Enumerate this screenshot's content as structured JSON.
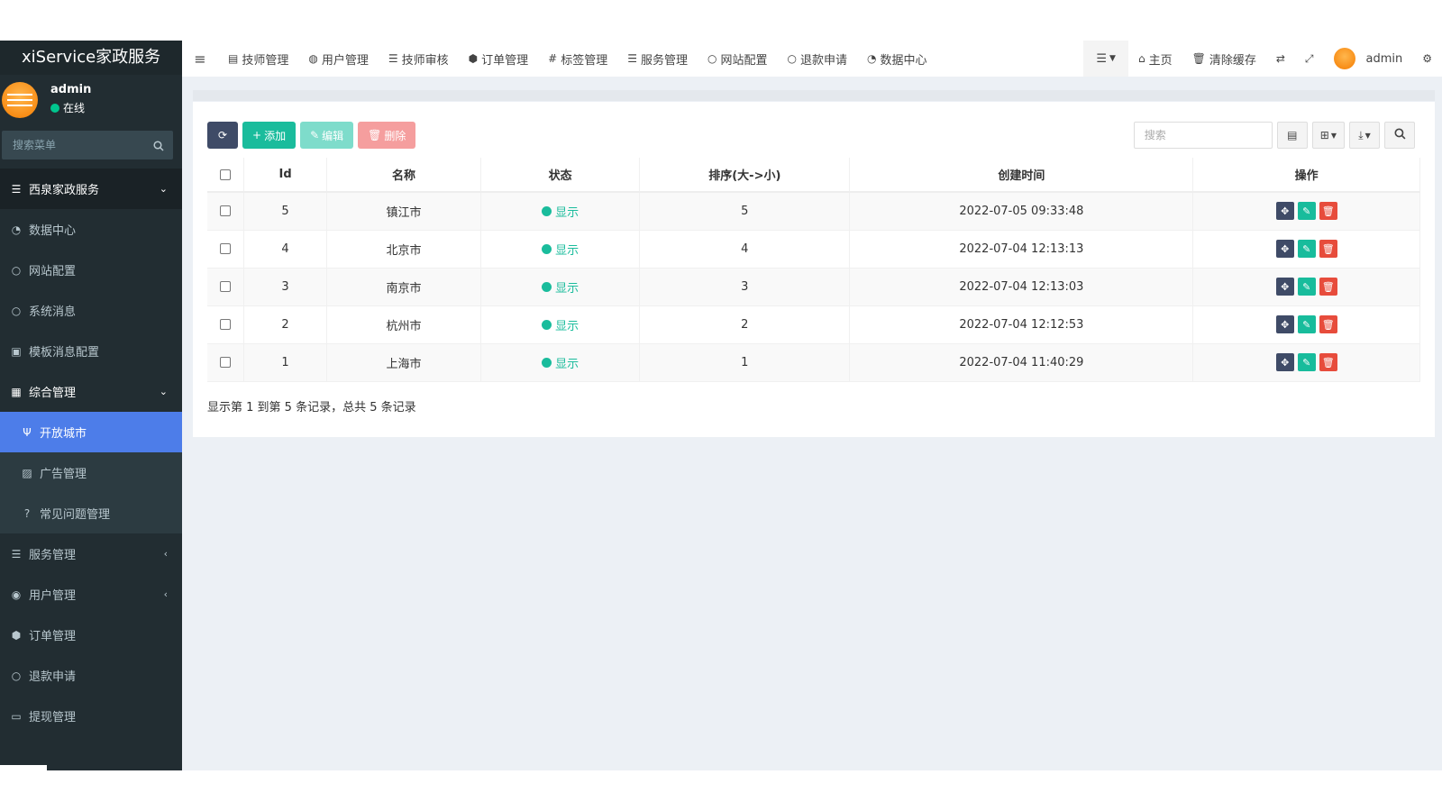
{
  "sidebar": {
    "logo": "xiService家政服务",
    "user": {
      "name": "admin",
      "status": "在线"
    },
    "search_placeholder": "搜索菜单",
    "items": [
      {
        "label": "西泉家政服务",
        "icon": "list-icon",
        "type": "header",
        "arrow": "⌄"
      },
      {
        "label": "数据中心",
        "icon": "dashboard-icon",
        "type": "item"
      },
      {
        "label": "网站配置",
        "icon": "circle-icon",
        "type": "item"
      },
      {
        "label": "系统消息",
        "icon": "circle-icon",
        "type": "item"
      },
      {
        "label": "模板消息配置",
        "icon": "template-icon",
        "type": "item"
      },
      {
        "label": "综合管理",
        "icon": "grid-icon",
        "type": "header2",
        "arrow": "⌄"
      },
      {
        "label": "开放城市",
        "icon": "fork-icon",
        "type": "sub-active"
      },
      {
        "label": "广告管理",
        "icon": "image-icon",
        "type": "sub"
      },
      {
        "label": "常见问题管理",
        "icon": "question-icon",
        "type": "sub"
      },
      {
        "label": "服务管理",
        "icon": "list-icon",
        "type": "item",
        "arrow": "‹"
      },
      {
        "label": "用户管理",
        "icon": "user-icon",
        "type": "item",
        "arrow": "‹"
      },
      {
        "label": "订单管理",
        "icon": "cube-icon",
        "type": "item"
      },
      {
        "label": "退款申请",
        "icon": "circle-icon",
        "type": "item"
      },
      {
        "label": "提现管理",
        "icon": "money-icon",
        "type": "item"
      }
    ]
  },
  "topnav": {
    "items": [
      {
        "label": "技师管理",
        "icon": "id-card-icon"
      },
      {
        "label": "用户管理",
        "icon": "users-icon"
      },
      {
        "label": "技师审核",
        "icon": "list-icon"
      },
      {
        "label": "订单管理",
        "icon": "cube-icon"
      },
      {
        "label": "标签管理",
        "icon": "hash-icon"
      },
      {
        "label": "服务管理",
        "icon": "list-icon"
      },
      {
        "label": "网站配置",
        "icon": "circle-icon"
      },
      {
        "label": "退款申请",
        "icon": "circle-icon"
      },
      {
        "label": "数据中心",
        "icon": "dashboard-icon"
      }
    ],
    "right": {
      "home": "主页",
      "clear_cache": "清除缓存",
      "admin": "admin"
    }
  },
  "toolbar": {
    "add": "添加",
    "edit": "编辑",
    "delete": "删除",
    "search_placeholder": "搜索"
  },
  "table": {
    "columns": [
      "Id",
      "名称",
      "状态",
      "排序(大->小)",
      "创建时间",
      "操作"
    ],
    "rows": [
      {
        "id": "5",
        "name": "镇江市",
        "status": "显示",
        "sort": "5",
        "created": "2022-07-05 09:33:48"
      },
      {
        "id": "4",
        "name": "北京市",
        "status": "显示",
        "sort": "4",
        "created": "2022-07-04 12:13:13"
      },
      {
        "id": "3",
        "name": "南京市",
        "status": "显示",
        "sort": "3",
        "created": "2022-07-04 12:13:03"
      },
      {
        "id": "2",
        "name": "杭州市",
        "status": "显示",
        "sort": "2",
        "created": "2022-07-04 12:12:53"
      },
      {
        "id": "1",
        "name": "上海市",
        "status": "显示",
        "sort": "1",
        "created": "2022-07-04 11:40:29"
      }
    ],
    "summary": "显示第 1 到第 5 条记录，总共 5 条记录"
  },
  "colors": {
    "sidebar_bg": "#222d32",
    "active": "#4d7de9",
    "accent": "#1abc9c",
    "danger": "#e74c3c"
  }
}
